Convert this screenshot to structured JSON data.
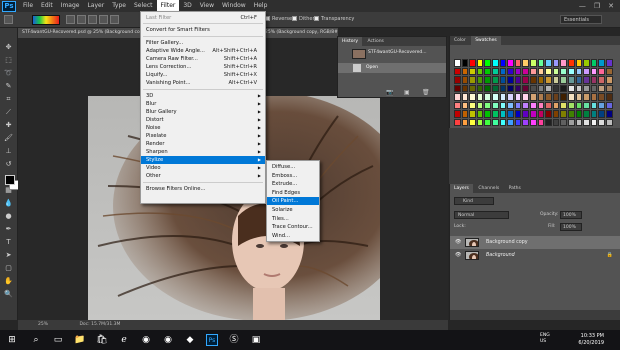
{
  "app": {
    "logo": "Ps"
  },
  "menubar": {
    "items": [
      "File",
      "Edit",
      "Image",
      "Layer",
      "Type",
      "Select",
      "Filter",
      "3D",
      "View",
      "Window",
      "Help"
    ],
    "active": "Filter",
    "window_controls": [
      "—",
      "❐",
      "✕"
    ]
  },
  "options": {
    "reverse": "Reverse",
    "dither": "Dither",
    "transparency": "Transparency",
    "workspace": "Essentials"
  },
  "document": {
    "tab_title": "STF4wantGU-Recovered.psd @ 25% (Background copy, RGB/...",
    "tab_title_right": "25% (Background copy, RGB/8#)",
    "zoom": "25%",
    "doc_size": "Doc: 15.7M/31.3M"
  },
  "filter_menu": {
    "items": [
      {
        "label": "Last Filter",
        "shortcut": "Ctrl+F",
        "disabled": true
      },
      {
        "label": "Convert for Smart Filters",
        "shortcut": ""
      },
      {
        "label": "Filter Gallery...",
        "shortcut": ""
      },
      {
        "label": "Adaptive Wide Angle...",
        "shortcut": "Alt+Shift+Ctrl+A"
      },
      {
        "label": "Camera Raw Filter...",
        "shortcut": "Shift+Ctrl+A"
      },
      {
        "label": "Lens Correction...",
        "shortcut": "Shift+Ctrl+R"
      },
      {
        "label": "Liquify...",
        "shortcut": "Shift+Ctrl+X"
      },
      {
        "label": "Vanishing Point...",
        "shortcut": "Alt+Ctrl+V"
      },
      {
        "label": "3D",
        "submenu": true
      },
      {
        "label": "Blur",
        "submenu": true
      },
      {
        "label": "Blur Gallery",
        "submenu": true
      },
      {
        "label": "Distort",
        "submenu": true
      },
      {
        "label": "Noise",
        "submenu": true
      },
      {
        "label": "Pixelate",
        "submenu": true
      },
      {
        "label": "Render",
        "submenu": true
      },
      {
        "label": "Sharpen",
        "submenu": true
      },
      {
        "label": "Stylize",
        "submenu": true,
        "highlighted": true
      },
      {
        "label": "Video",
        "submenu": true
      },
      {
        "label": "Other",
        "submenu": true
      },
      {
        "label": "Browse Filters Online...",
        "shortcut": ""
      }
    ]
  },
  "stylize_menu": {
    "items": [
      "Diffuse...",
      "Emboss...",
      "Extrude...",
      "Find Edges",
      "Oil Paint...",
      "Solarize",
      "Tiles...",
      "Trace Contour...",
      "Wind..."
    ],
    "highlighted": "Oil Paint..."
  },
  "history": {
    "tabs": [
      "History",
      "Actions"
    ],
    "snapshot": "STF4wantGU-Recovered...",
    "step": "Open"
  },
  "swatches": {
    "tabs": [
      "Color",
      "Swatches"
    ]
  },
  "layers": {
    "tabs": [
      "Layers",
      "Channels",
      "Paths"
    ],
    "kind": "Kind",
    "blend_mode": "Normal",
    "opacity_label": "Opacity:",
    "opacity_value": "100%",
    "lock_label": "Lock:",
    "fill_label": "Fill:",
    "fill_value": "100%",
    "rows": [
      {
        "name": "Background copy",
        "selected": true
      },
      {
        "name": "Background",
        "selected": false
      }
    ]
  },
  "taskbar": {
    "time": "10:33 PM",
    "date": "6/20/2019",
    "lang": "ENG",
    "region": "US"
  },
  "colors": {
    "accent": "#0078d7",
    "panel": "#535353"
  }
}
